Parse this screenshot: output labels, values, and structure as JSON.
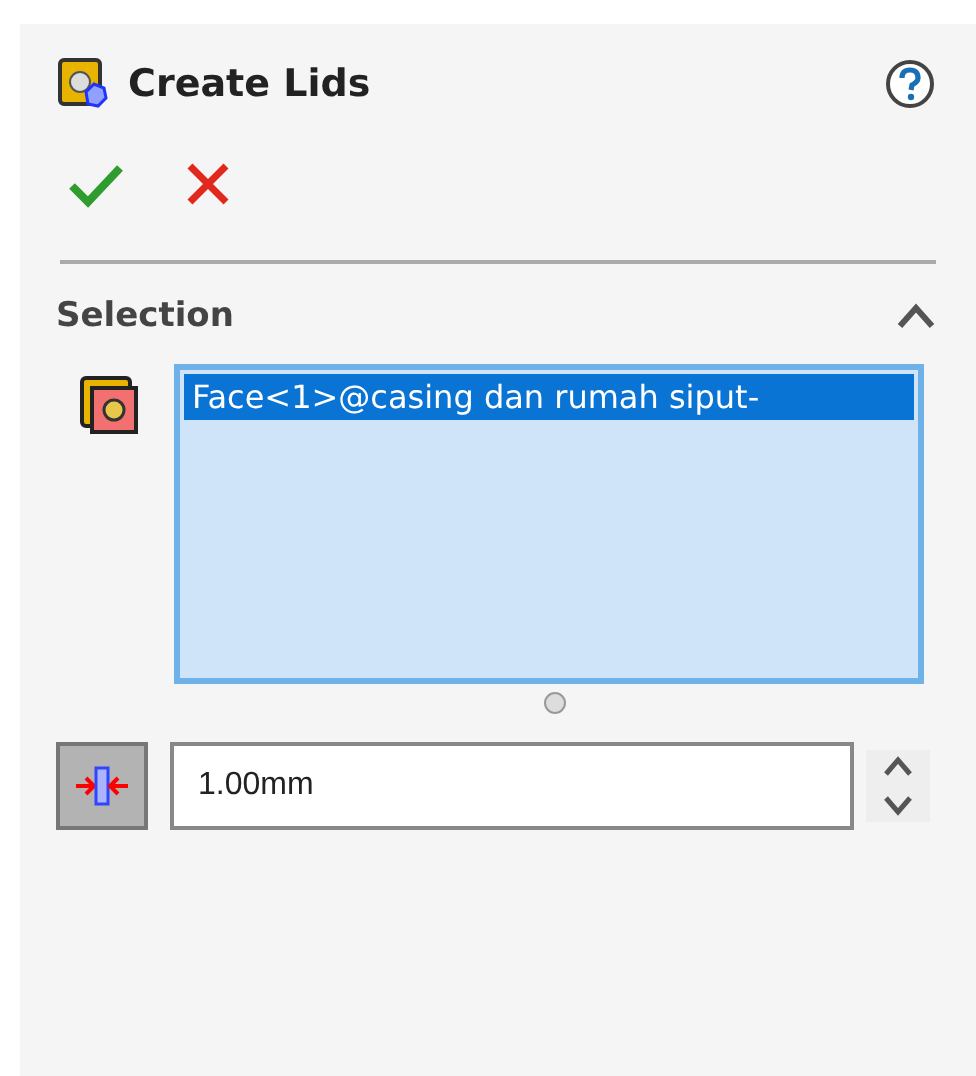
{
  "panel": {
    "title": "Create Lids"
  },
  "section": {
    "title": "Selection",
    "expanded": true,
    "items": [
      {
        "label": "Face<1>@casing dan rumah siput-",
        "selected": true
      }
    ],
    "thickness": {
      "value": "1.00mm"
    }
  }
}
